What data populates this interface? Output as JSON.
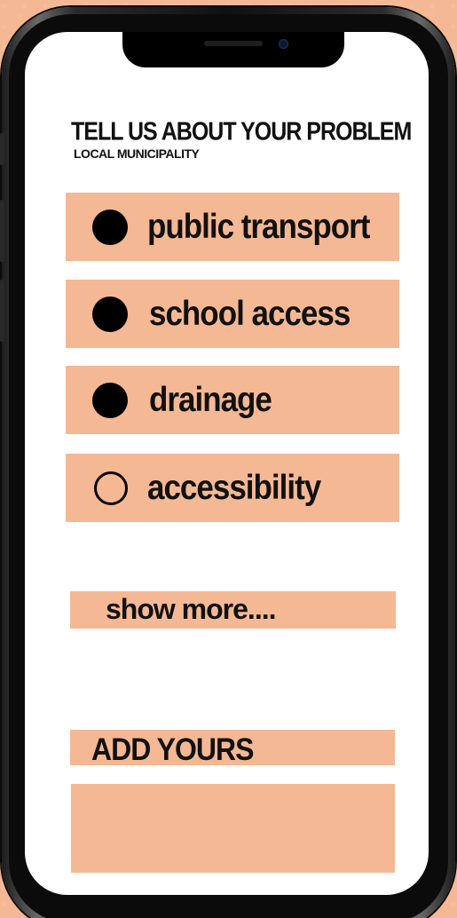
{
  "header": {
    "title": "TELL US ABOUT YOUR PROBLEM",
    "subtitle": "LOCAL MUNICIPALITY"
  },
  "options": [
    {
      "label": "public transport",
      "selected": true
    },
    {
      "label": "school access",
      "selected": true
    },
    {
      "label": "drainage",
      "selected": true
    },
    {
      "label": "accessibility",
      "selected": false
    }
  ],
  "show_more": {
    "label": "show more...."
  },
  "add_yours": {
    "label": "ADD YOURS",
    "value": ""
  },
  "colors": {
    "background": "#f5b894",
    "option_fill": "#f5b894",
    "screen": "#ffffff",
    "text": "#111111"
  }
}
